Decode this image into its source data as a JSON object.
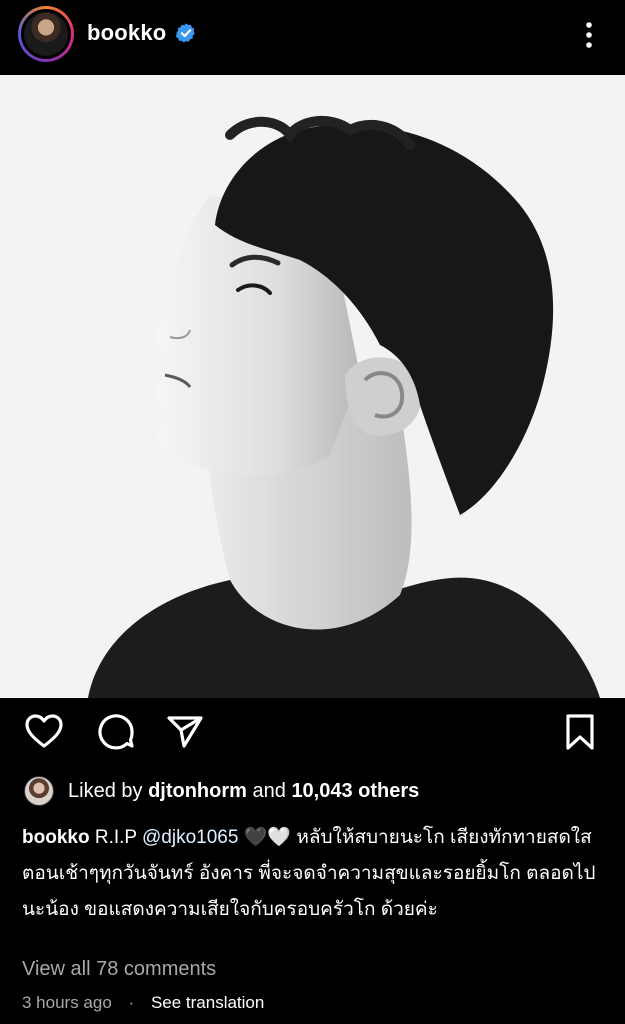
{
  "post": {
    "username": "bookko",
    "verified": true
  },
  "likes": {
    "prefix": "Liked by",
    "liker": "djtonhorm",
    "connector": "and",
    "others": "10,043 others"
  },
  "caption": {
    "username": "bookko",
    "text_before_mention": "R.I.P",
    "mention": "@djko1065",
    "hearts": "🖤🤍",
    "text": "หลับให้สบายนะโก เสียงทักทายสดใส ตอนเช้าๆทุกวันจันทร์ อังคาร พี่จะจดจำความสุขและรอยยิ้มโก ตลอดไปนะน้อง ขอแสดงความเสียใจกับครอบครัวโก ด้วยค่ะ"
  },
  "comments": {
    "view_all_label": "View all 78 comments"
  },
  "meta": {
    "timestamp": "3 hours ago",
    "separator": "·",
    "translation_label": "See translation"
  },
  "icons": {
    "verified": "verified-badge-icon",
    "more": "more-vertical-icon",
    "like": "heart-icon",
    "comment": "comment-icon",
    "share": "share-icon",
    "save": "bookmark-icon"
  },
  "colors": {
    "background": "#000000",
    "verified": "#3897f0",
    "muted_text": "#a8a8a8"
  }
}
